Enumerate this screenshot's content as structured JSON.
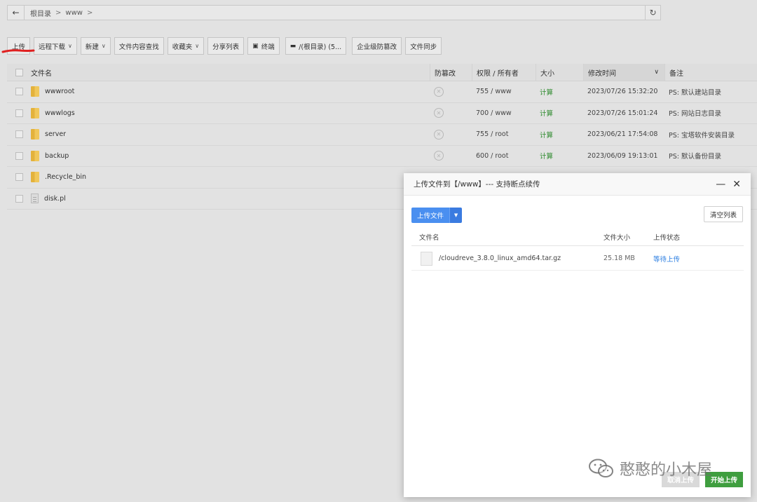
{
  "address_bar": {
    "crumbs": [
      "根目录",
      "www"
    ],
    "separators": [
      ">",
      ">"
    ]
  },
  "toolbar": {
    "upload": "上传",
    "remote_download": "远程下载",
    "new": "新建",
    "content_search": "文件内容查找",
    "favorites": "收藏夹",
    "share_list": "分享列表",
    "terminal": "终端",
    "disk": "/(根目录) (5...",
    "enterprise_tamper": "企业级防篡改",
    "file_sync": "文件同步"
  },
  "table": {
    "headers": {
      "name": "文件名",
      "tamper": "防篡改",
      "perm": "权限 / 所有者",
      "size": "大小",
      "mtime": "修改时间",
      "note": "备注"
    },
    "rows": [
      {
        "name": "wwwroot",
        "type": "folder",
        "perm": "755 / www",
        "size": "计算",
        "mtime": "2023/07/26 15:32:20",
        "note": "PS: 默认建站目录"
      },
      {
        "name": "wwwlogs",
        "type": "folder",
        "perm": "700 / www",
        "size": "计算",
        "mtime": "2023/07/26 15:01:24",
        "note": "PS: 网站日志目录"
      },
      {
        "name": "server",
        "type": "folder",
        "perm": "755 / root",
        "size": "计算",
        "mtime": "2023/06/21 17:54:08",
        "note": "PS: 宝塔软件安装目录"
      },
      {
        "name": "backup",
        "type": "folder",
        "perm": "600 / root",
        "size": "计算",
        "mtime": "2023/06/09 19:13:01",
        "note": "PS: 默认备份目录"
      },
      {
        "name": ".Recycle_bin",
        "type": "folder"
      },
      {
        "name": "disk.pl",
        "type": "file"
      }
    ]
  },
  "modal": {
    "title": "上传文件到【/www】--- 支持断点续传",
    "upload_btn": "上传文件",
    "clear_btn": "清空列表",
    "col_name": "文件名",
    "col_size": "文件大小",
    "col_status": "上传状态",
    "file": {
      "name": "/cloudreve_3.8.0_linux_amd64.tar.gz",
      "size": "25.18 MB",
      "status": "等待上传"
    },
    "cancel_btn": "取消上传",
    "start_btn": "开始上传"
  },
  "watermark": "憨憨的小木屋",
  "colors": {
    "accent_blue": "#4a8ff0",
    "start_green": "#3f9e3f",
    "size_green": "#2e8b2e",
    "annotation_red": "#e02020"
  }
}
